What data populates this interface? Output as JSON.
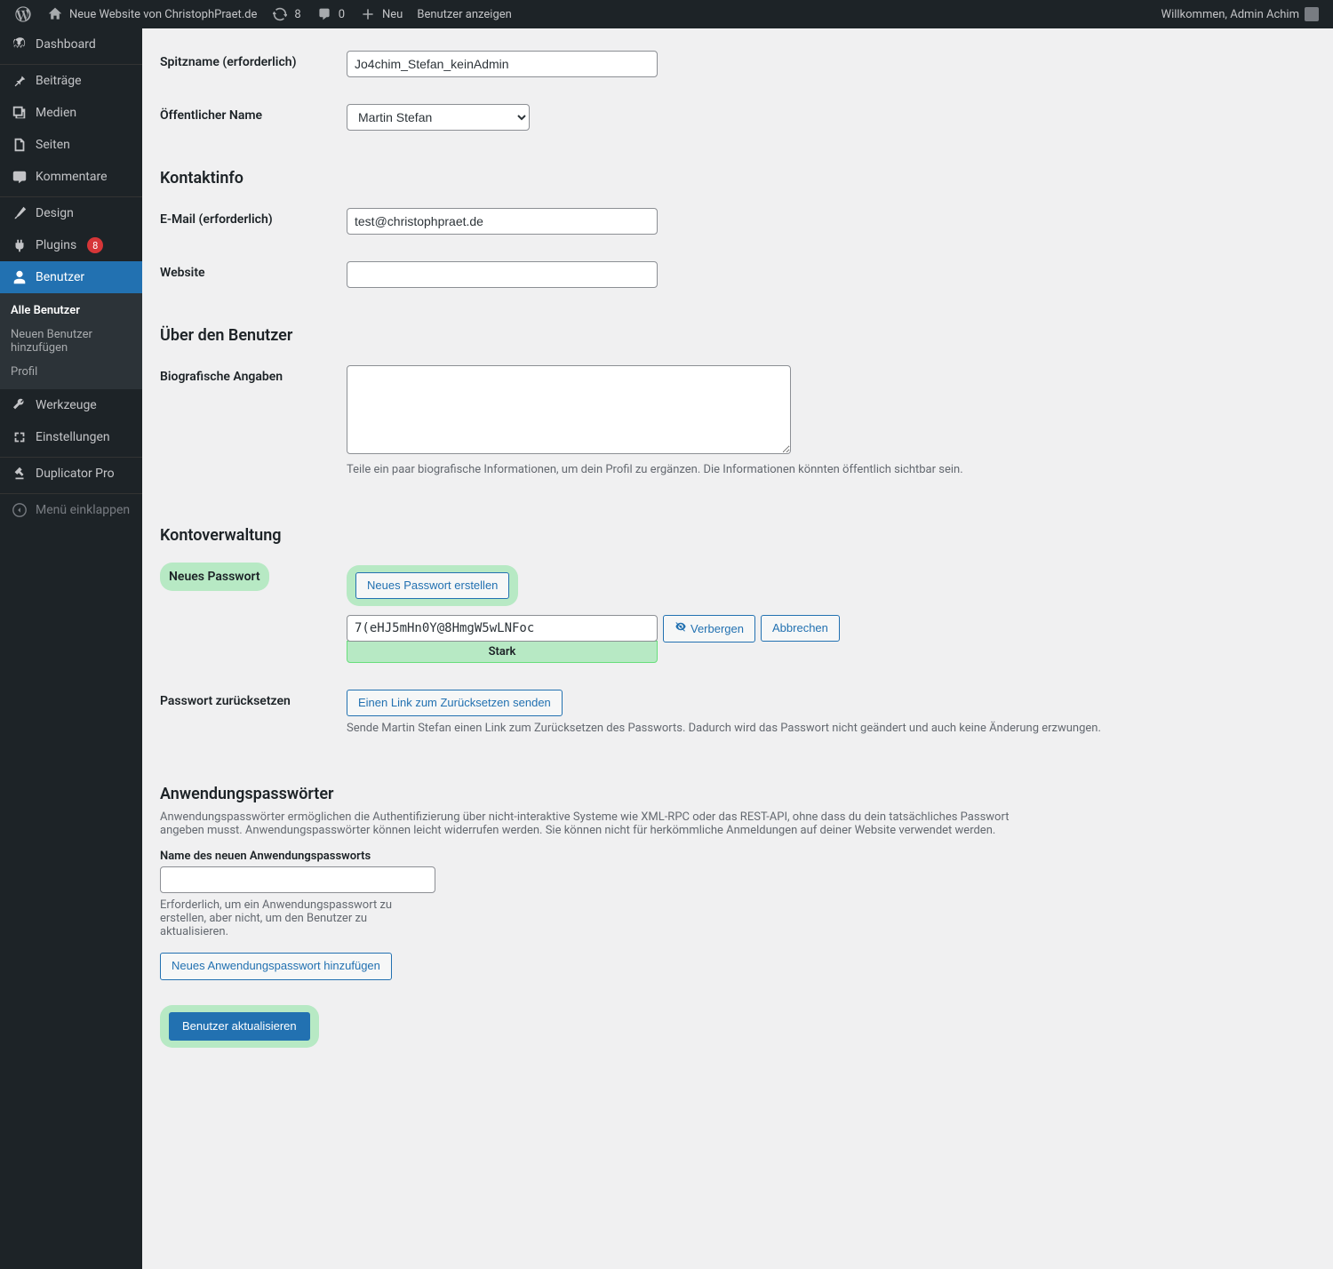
{
  "adminbar": {
    "site_title": "Neue Website von ChristophPraet.de",
    "updates_count": "8",
    "comments_count": "0",
    "new_label": "Neu",
    "view_user": "Benutzer anzeigen",
    "welcome": "Willkommen, Admin Achim"
  },
  "sidebar": {
    "dashboard": "Dashboard",
    "posts": "Beiträge",
    "media": "Medien",
    "pages": "Seiten",
    "comments": "Kommentare",
    "design": "Design",
    "plugins": "Plugins",
    "plugins_badge": "8",
    "users": "Benutzer",
    "sub_all": "Alle Benutzer",
    "sub_new": "Neuen Benutzer hinzufügen",
    "sub_profile": "Profil",
    "tools": "Werkzeuge",
    "settings": "Einstellungen",
    "duplicator": "Duplicator Pro",
    "collapse": "Menü einklappen"
  },
  "form": {
    "nickname_label": "Spitzname (erforderlich)",
    "nickname_value": "Jo4chim_Stefan_keinAdmin",
    "displayname_label": "Öffentlicher Name",
    "displayname_value": "Martin Stefan",
    "contact_heading": "Kontaktinfo",
    "email_label": "E-Mail (erforderlich)",
    "email_value": "test@christophpraet.de",
    "website_label": "Website",
    "website_value": "",
    "about_heading": "Über den Benutzer",
    "bio_label": "Biografische Angaben",
    "bio_desc": "Teile ein paar biografische Informationen, um dein Profil zu ergänzen. Die Informationen könnten öffentlich sichtbar sein.",
    "account_heading": "Kontoverwaltung",
    "newpw_label": "Neues Passwort",
    "newpw_button": "Neues Passwort erstellen",
    "pw_value": "7(eHJ5mHn0Y@8HmgW5wLNFoc",
    "pw_strength": "Stark",
    "hide_button": "Verbergen",
    "cancel_button": "Abbrechen",
    "reset_label": "Passwort zurücksetzen",
    "reset_button": "Einen Link zum Zurücksetzen senden",
    "reset_desc": "Sende Martin Stefan einen Link zum Zurücksetzen des Passworts. Dadurch wird das Passwort nicht geändert und auch keine Änderung erzwungen.",
    "apppw_heading": "Anwendungspasswörter",
    "apppw_desc": "Anwendungspasswörter ermöglichen die Authentifizierung über nicht-interaktive Systeme wie XML-RPC oder das REST-API, ohne dass du dein tatsächliches Passwort angeben musst. Anwendungspasswörter können leicht widerrufen werden. Sie können nicht für herkömmliche Anmeldungen auf deiner Website verwendet werden.",
    "apppw_name_label": "Name des neuen Anwendungspassworts",
    "apppw_name_desc": "Erforderlich, um ein Anwendungspasswort zu erstellen, aber nicht, um den Benutzer zu aktualisieren.",
    "apppw_add_button": "Neues Anwendungspasswort hinzufügen",
    "submit_button": "Benutzer aktualisieren"
  }
}
